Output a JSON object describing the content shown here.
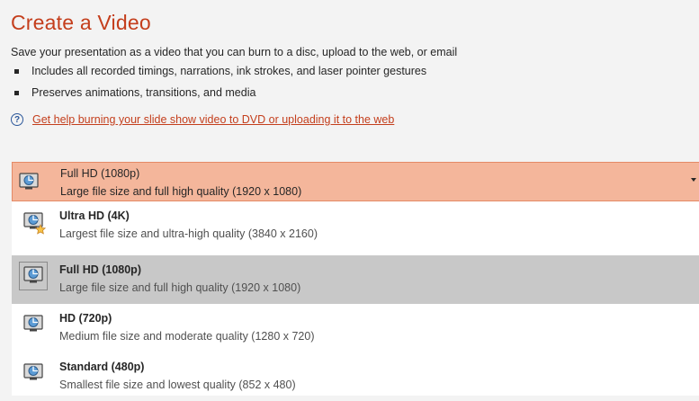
{
  "header": {
    "title": "Create a Video",
    "description": "Save your presentation as a video that you can burn to a disc, upload to the web, or email",
    "bullets": [
      "Includes all recorded timings, narrations, ink strokes, and laser pointer gestures",
      "Preserves animations, transitions, and media"
    ],
    "help_icon": "question-circle-icon",
    "help_link": "Get help burning your slide show video to DVD or uploading it to the web"
  },
  "colors": {
    "title": "#c43e1c",
    "selector_bg": "#f4b69b",
    "selected_option_bg": "#c8c8c8",
    "link": "#c43e1c"
  },
  "quality_dropdown": {
    "selected": {
      "name": "Full HD (1080p)",
      "detail": "Large file size and full high quality (1920 x 1080)",
      "icon": "display-icon"
    },
    "options": [
      {
        "name": "Ultra HD (4K)",
        "detail": "Largest file size and ultra-high quality (3840 x 2160)",
        "icon": "display-star-icon"
      },
      {
        "name": "Full HD (1080p)",
        "detail": "Large file size and full high quality (1920 x 1080)",
        "icon": "display-icon"
      },
      {
        "name": "HD (720p)",
        "detail": "Medium file size and moderate quality (1280 x 720)",
        "icon": "display-icon"
      },
      {
        "name": "Standard (480p)",
        "detail": "Smallest file size and lowest quality (852 x 480)",
        "icon": "display-icon"
      }
    ]
  }
}
